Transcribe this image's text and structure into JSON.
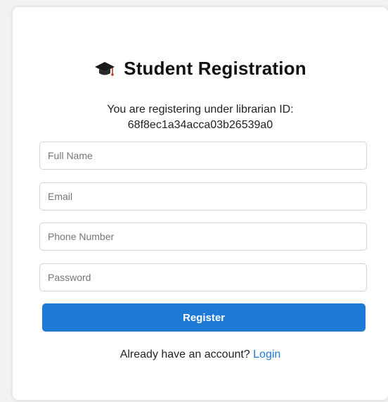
{
  "header": {
    "icon": "graduation-cap-icon",
    "title": "Student Registration"
  },
  "intro": {
    "line1": "You are registering under librarian ID:",
    "librarian_id": "68f8ec1a34acca03b26539a0"
  },
  "form": {
    "full_name": {
      "placeholder": "Full Name",
      "value": ""
    },
    "email": {
      "placeholder": "Email",
      "value": ""
    },
    "phone": {
      "placeholder": "Phone Number",
      "value": ""
    },
    "password": {
      "placeholder": "Password",
      "value": ""
    },
    "submit_label": "Register"
  },
  "footer": {
    "prompt": "Already have an account?",
    "login_label": "Login"
  },
  "colors": {
    "accent": "#1d7ad6",
    "background": "#f2f2f2",
    "card": "#ffffff"
  }
}
